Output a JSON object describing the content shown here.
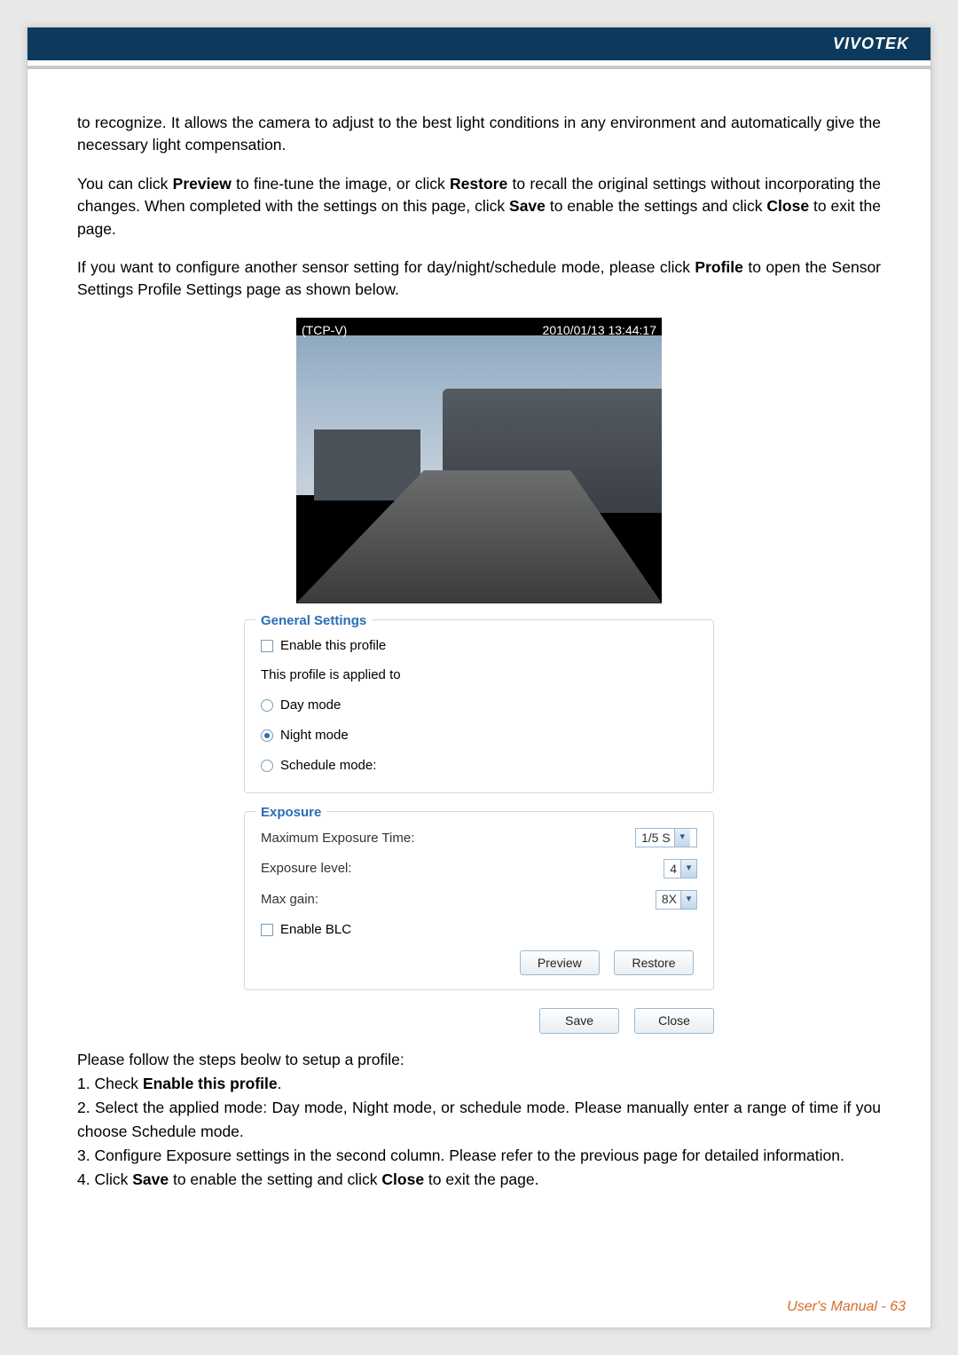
{
  "header": {
    "brand": "VIVOTEK"
  },
  "intro": {
    "para1": "to recognize. It allows the camera to adjust to the best light conditions in any environment and automatically give the necessary light compensation.",
    "para2a": "You can click ",
    "para2b_bold": "Preview",
    "para2c": " to fine-tune the image, or click ",
    "para2d_bold": "Restore",
    "para2e": " to recall the original settings without incorporating the changes. When completed with the settings on this page, click ",
    "para2f_bold": "Save",
    "para2g": " to enable the settings and click ",
    "para2h_bold": "Close",
    "para2i": " to exit the page.",
    "para3a": "If you want to configure another sensor setting for day/night/schedule mode, please click ",
    "para3b_bold": "Profile",
    "para3c": " to open the Sensor Settings Profile Settings page as shown below."
  },
  "preview": {
    "name_overlay": "(TCP-V)",
    "timestamp": "2010/01/13 13:44:17"
  },
  "general_settings": {
    "legend": "General Settings",
    "enable_profile_label": "Enable this profile",
    "applied_to_label": "This profile is applied to",
    "modes": {
      "day": "Day mode",
      "night": "Night mode",
      "schedule": "Schedule mode:",
      "selected": "night"
    }
  },
  "exposure": {
    "legend": "Exposure",
    "max_exposure_time_label": "Maximum Exposure Time:",
    "max_exposure_time_value": "1/5 S",
    "exposure_level_label": "Exposure level:",
    "exposure_level_value": "4",
    "max_gain_label": "Max gain:",
    "max_gain_value": "8X",
    "enable_blc_label": "Enable BLC",
    "buttons": {
      "preview": "Preview",
      "restore": "Restore"
    }
  },
  "bottom_buttons": {
    "save": "Save",
    "close": "Close"
  },
  "steps": {
    "intro": "Please follow the steps beolw to setup a profile:",
    "s1a": "1. Check ",
    "s1b_bold": "Enable this profile",
    "s1c": ".",
    "s2": "2. Select the applied mode: Day mode, Night mode, or schedule mode. Please manually enter a range of time if you choose Schedule mode.",
    "s3": "3. Configure Exposure settings in the second column. Please refer to the previous page for detailed information.",
    "s4a": "4. Click ",
    "s4b_bold": "Save",
    "s4c": " to enable the setting and click ",
    "s4d_bold": "Close",
    "s4e": " to exit the page."
  },
  "footer": {
    "label": "User's Manual - 63"
  }
}
